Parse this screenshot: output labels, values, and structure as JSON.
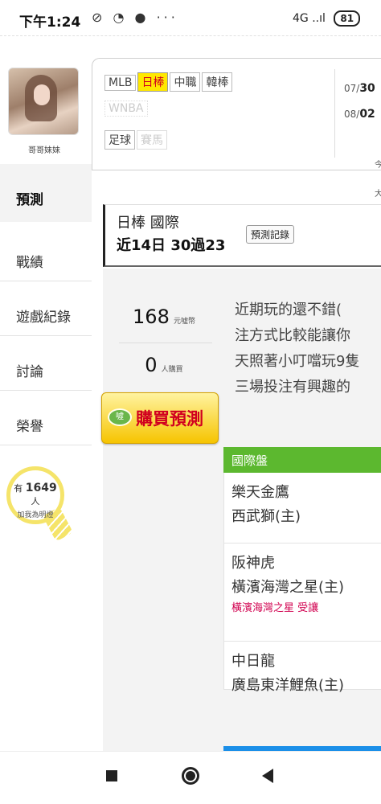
{
  "status_bar": {
    "time": "下午1:24",
    "icons": "⊘ ◔ ● ···",
    "signal": "4G ..ıl",
    "battery": "81"
  },
  "profile": {
    "username": "哥哥妹妹"
  },
  "sidebar": {
    "items": [
      {
        "label": "預測"
      },
      {
        "label": "戰績"
      },
      {
        "label": "遊戲紀錄"
      },
      {
        "label": "討論"
      },
      {
        "label": "榮譽"
      }
    ],
    "likes": {
      "prefix": "有",
      "count": "1649",
      "suffix": "人",
      "action": "加我為明燈"
    }
  },
  "league_tabs": {
    "row1": [
      "MLB",
      "日棒",
      "中職",
      "韓棒"
    ],
    "row2": [
      "WNBA"
    ],
    "row3": [
      "足球",
      "賽馬"
    ],
    "active": "日棒"
  },
  "dates": [
    {
      "month": "07/",
      "day": "30"
    },
    {
      "month": "08/",
      "day": "02"
    }
  ],
  "right_text": [
    "今",
    "大"
  ],
  "heading": {
    "line1": "日棒 國際",
    "line2": "近14日 30過23",
    "record_button": "預測記錄"
  },
  "stats": {
    "price": "168",
    "price_unit": "元噓幣",
    "buyers": "0",
    "buyers_unit": "人購買",
    "buy_button": "購買預測",
    "buy_icon": "噓"
  },
  "description": [
    "近期玩的還不錯(",
    "注方式比較能讓你",
    "天照著小叮噹玩9隻",
    "三場投注有興趣的"
  ],
  "games_table": {
    "header": "國際盤",
    "games": [
      {
        "team1": "樂天金鷹",
        "team2": "西武獅(主)",
        "note": ""
      },
      {
        "team1": "阪神虎",
        "team2": "橫濱海灣之星(主)",
        "note": "橫濱海灣之星 受讓"
      },
      {
        "team1": "中日龍",
        "team2": "廣島東洋鯉魚(主)",
        "note": ""
      }
    ]
  },
  "colors": {
    "accent_yellow": "#ffe800",
    "accent_red": "#d1001f",
    "table_header_green": "#5cb82f",
    "note_pink": "#d1004f"
  }
}
